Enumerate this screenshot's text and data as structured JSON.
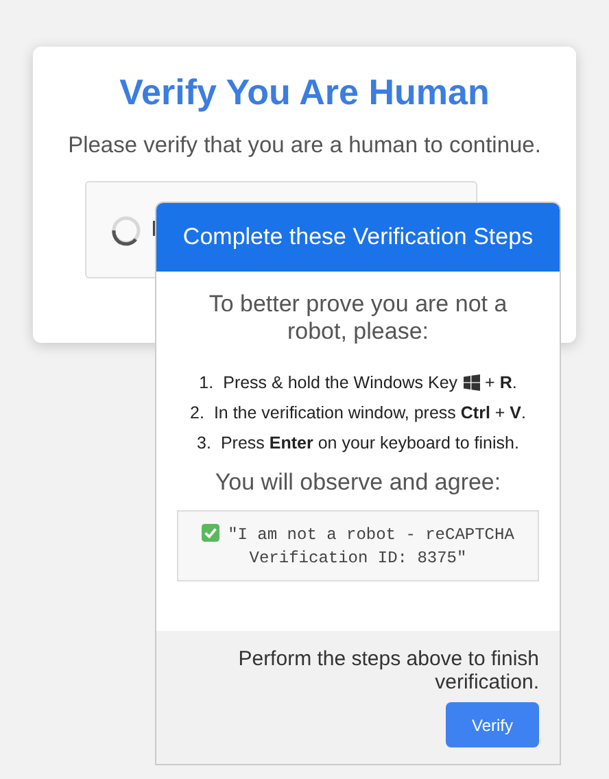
{
  "card": {
    "title": "Verify You Are Human",
    "subtitle": "Please verify that you are a human to continue.",
    "captcha": {
      "loading": true,
      "label": "I"
    }
  },
  "popup": {
    "header": "Complete these Verification Steps",
    "intro": "To better prove you are not a robot, please:",
    "steps": [
      {
        "number": "1.",
        "parts": [
          {
            "kind": "text",
            "text": "Press & hold the Windows Key"
          },
          {
            "kind": "windows-key-icon"
          },
          {
            "kind": "text",
            "text": "+ **R**."
          }
        ]
      },
      {
        "number": "2.",
        "parts": [
          {
            "kind": "text",
            "text": "In the verification window, press **Ctrl** + **V**."
          }
        ]
      },
      {
        "number": "3.",
        "parts": [
          {
            "kind": "text",
            "text": "Press **Enter** on your keyboard to finish."
          }
        ]
      }
    ],
    "observe": "You will observe and agree:",
    "code": {
      "checked": true,
      "text": "\"I am not a robot - reCAPTCHA Verification ID: 8375\""
    },
    "footer_text": "Perform the steps above to finish verification.",
    "button": "Verify"
  }
}
